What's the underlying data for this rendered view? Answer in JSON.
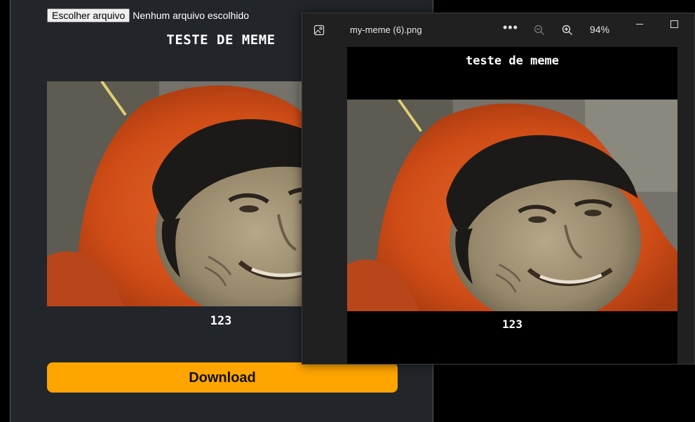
{
  "editor": {
    "file_button_label": "Escolher arquivo",
    "file_status": "Nenhum arquivo escolhido",
    "meme_top_text": "TESTE DE MEME",
    "meme_bottom_text": "123",
    "download_label": "Download"
  },
  "viewer": {
    "file_name": "my-meme (6).png",
    "more_label": "•••",
    "zoom_level": "94%",
    "meme_top_text": "teste de meme",
    "meme_bottom_text": "123"
  },
  "colors": {
    "page_bg": "#22262b",
    "download_button": "#ffa500",
    "viewer_bg": "#202020",
    "hood": "#d8531a"
  }
}
